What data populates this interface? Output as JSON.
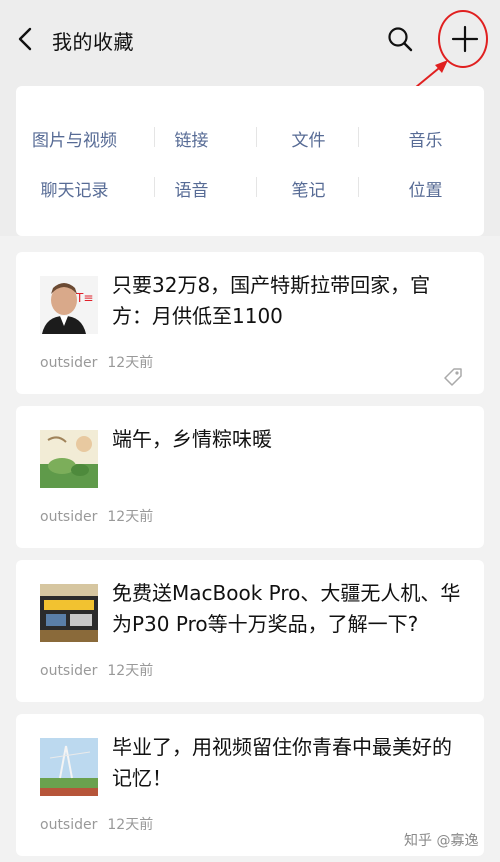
{
  "nav": {
    "title": "我的收藏",
    "back_icon": "chevron-left-icon",
    "search_icon": "search-icon",
    "add_icon": "plus-icon",
    "annotation_color": "#e02020"
  },
  "categories": [
    {
      "label": "图片与视频"
    },
    {
      "label": "链接"
    },
    {
      "label": "文件"
    },
    {
      "label": "音乐"
    },
    {
      "label": "聊天记录"
    },
    {
      "label": "语音"
    },
    {
      "label": "笔记"
    },
    {
      "label": "位置"
    }
  ],
  "items": [
    {
      "title": "只要32万8，国产特斯拉带回家，官方：月供低至1100",
      "source": "outsider",
      "time": "12天前",
      "tag_icon": "tag-icon"
    },
    {
      "title": "端午，乡情粽味暖",
      "source": "outsider",
      "time": "12天前"
    },
    {
      "title": "免费送MacBook Pro、大疆无人机、华为P30 Pro等十万奖品，了解一下?",
      "source": "outsider",
      "time": "12天前"
    },
    {
      "title": "毕业了，用视频留住你青春中最美好的记忆！",
      "source": "outsider",
      "time": "12天前"
    }
  ],
  "watermark": "知乎 @寡逸",
  "colors": {
    "link_blue": "#576b95",
    "meta_gray": "#999999",
    "background": "#ededed"
  }
}
